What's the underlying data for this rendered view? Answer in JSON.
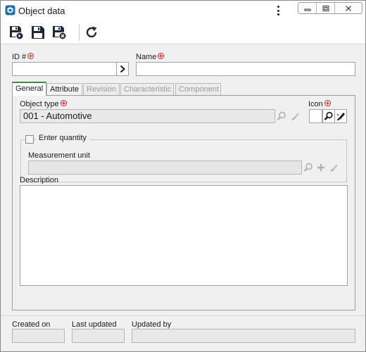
{
  "window": {
    "title": "Object data",
    "app_icon": "cube-app-icon",
    "controls": [
      "minimize-icon",
      "maximize-icon",
      "close-icon"
    ]
  },
  "toolbar": {
    "buttons": [
      "save-and-new-icon",
      "save-icon",
      "save-and-close-icon",
      "refresh-icon"
    ]
  },
  "form": {
    "id_label": "ID #",
    "id_value": "",
    "name_label": "Name",
    "name_value": ""
  },
  "tabs": [
    {
      "label": "General",
      "state": "active"
    },
    {
      "label": "Attribute",
      "state": "enabled"
    },
    {
      "label": "Revision",
      "state": "disabled"
    },
    {
      "label": "Characteristic",
      "state": "disabled"
    },
    {
      "label": "Component",
      "state": "disabled"
    }
  ],
  "general": {
    "object_type_label": "Object type",
    "object_type_value": "001 - Automotive",
    "icon_label": "Icon",
    "enter_quantity_label": "Enter quantity",
    "enter_quantity_checked": false,
    "measurement_unit_label": "Measurement unit",
    "measurement_unit_value": "",
    "description_label": "Description",
    "description_value": ""
  },
  "footer": {
    "created_on_label": "Created on",
    "created_on_value": "",
    "last_updated_label": "Last updated",
    "last_updated_value": "",
    "updated_by_label": "Updated by",
    "updated_by_value": ""
  },
  "colors": {
    "required": "#d32020",
    "active_tab_accent": "#3a8f3a",
    "app_icon": "#1f6fa8"
  }
}
